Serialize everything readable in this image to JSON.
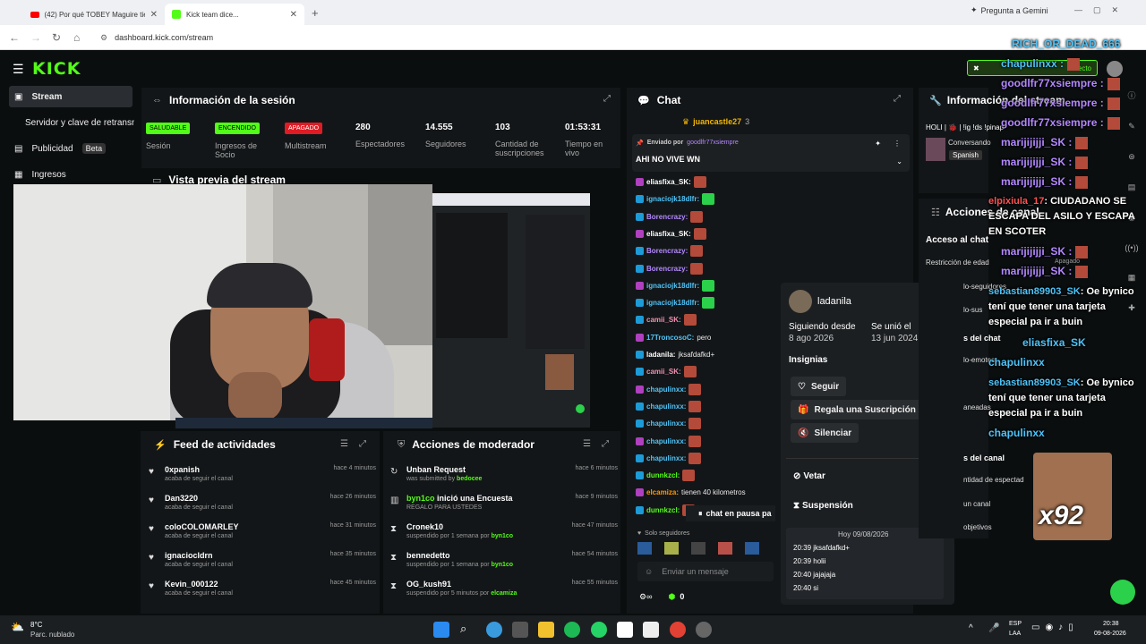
{
  "browser": {
    "tabs": [
      {
        "title": "(42) Por qué TOBEY Maguire tie"
      },
      {
        "title": "Kick team dice..."
      }
    ],
    "url": "dashboard.kick.com/stream",
    "gemini": "Pregunta a Gemini"
  },
  "kick": {
    "logo": "KICK",
    "sidebar": [
      {
        "label": "Stream"
      },
      {
        "label": "Servidor y clave de retransn"
      },
      {
        "label": "Publicidad",
        "badge": "Beta"
      },
      {
        "label": "Ingresos"
      }
    ],
    "session": {
      "title": "Información de la sesión",
      "stats": [
        {
          "pill": "SALUDABLE",
          "label": "Sesión",
          "color": "#53fc18"
        },
        {
          "pill": "ENCENDIDO",
          "label": "Ingresos de Socio",
          "color": "#53fc18"
        },
        {
          "pill": "APAGADO",
          "label": "Multistream",
          "color": "#e01b24"
        },
        {
          "value": "280",
          "label": "Espectadores"
        },
        {
          "value": "14.555",
          "label": "Seguidores"
        },
        {
          "value": "103",
          "label": "Cantidad de suscripciones"
        },
        {
          "value": "01:53:31",
          "label": "Tiempo en vivo"
        }
      ]
    },
    "preview": {
      "title": "Vista previa del stream"
    },
    "feed": {
      "title": "Feed de actividades",
      "rows": [
        {
          "name": "0xpanish",
          "sub": "acaba de seguir el canal",
          "time": "hace 4 minutos"
        },
        {
          "name": "Dan3220",
          "sub": "acaba de seguir el canal",
          "time": "hace 26 minutos"
        },
        {
          "name": "coloCOLOMARLEY",
          "sub": "acaba de seguir el canal",
          "time": "hace 31 minutos"
        },
        {
          "name": "ignaciocldrn",
          "sub": "acaba de seguir el canal",
          "time": "hace 35 minutos"
        },
        {
          "name": "Kevin_000122",
          "sub": "acaba de seguir el canal",
          "time": "hace 45 minutos"
        }
      ]
    },
    "mod": {
      "title": "Acciones de moderador",
      "rows": [
        {
          "icon": "refresh-icon",
          "name": "Unban Request",
          "sub": "was submitted by",
          "who": "bedocee",
          "time": "hace 6 minutos"
        },
        {
          "icon": "poll-icon",
          "name": "byn1co",
          "name2": "inició una Encuesta",
          "sub": "REGALO PARA USTEDES",
          "time": "hace 9 minutos"
        },
        {
          "icon": "hourglass-icon",
          "name": "Cronek10",
          "sub": "suspendido por 1 semana por",
          "who": "byn1co",
          "time": "hace 47 minutos"
        },
        {
          "icon": "hourglass-icon",
          "name": "bennedetto",
          "sub": "suspendido por 1 semana por",
          "who": "byn1co",
          "time": "hace 54 minutos"
        },
        {
          "icon": "hourglass-icon",
          "name": "OG_kush91",
          "sub": "suspendido por 5 minutos por",
          "who": "elcamiza",
          "time": "hace 55 minutos"
        }
      ]
    },
    "chat": {
      "title": "Chat",
      "top_user": "juancastle27",
      "top_count": "3",
      "pinned_by_label": "Enviado por",
      "pinned_by": "goodlfr77xsiempre",
      "pinned_text": "AHI NO VIVE WN",
      "lines": [
        {
          "user": "eliasfixa_SK:",
          "color": "#fff",
          "text": ""
        },
        {
          "user": "ignaciojk18dlfr:",
          "color": "#4fc3f7",
          "text": ""
        },
        {
          "user": "Borencrazy:",
          "color": "#b388ff",
          "text": ""
        },
        {
          "user": "eliasfixa_SK:",
          "color": "#fff",
          "text": ""
        },
        {
          "user": "Borencrazy:",
          "color": "#b388ff",
          "text": ""
        },
        {
          "user": "Borencrazy:",
          "color": "#b388ff",
          "text": ""
        },
        {
          "user": "ignaciojk18dlfr:",
          "color": "#4fc3f7",
          "text": ""
        },
        {
          "user": "ignaciojk18dlfr:",
          "color": "#4fc3f7",
          "text": ""
        },
        {
          "user": "camii_SK:",
          "color": "#f48fb1",
          "text": ""
        },
        {
          "user": "17TroncosoC:",
          "color": "#4fc3f7",
          "text": "pero"
        },
        {
          "user": "ladanila:",
          "color": "#fff",
          "text": "jksafdafkd+"
        },
        {
          "user": "camii_SK:",
          "color": "#f48fb1",
          "text": ""
        },
        {
          "user": "chapulinxx:",
          "color": "#4fc3f7",
          "text": ""
        },
        {
          "user": "chapulinxx:",
          "color": "#4fc3f7",
          "text": ""
        },
        {
          "user": "chapulinxx:",
          "color": "#4fc3f7",
          "text": ""
        },
        {
          "user": "chapulinxx:",
          "color": "#4fc3f7",
          "text": ""
        },
        {
          "user": "chapulinxx:",
          "color": "#4fc3f7",
          "text": ""
        },
        {
          "user": "dunnkzcl:",
          "color": "#53fc18",
          "text": ""
        },
        {
          "user": "elcamiza:",
          "color": "#ff9800",
          "text": "tienen 40 kilometros"
        },
        {
          "user": "dunnkzcl:",
          "color": "#53fc18",
          "text": ""
        }
      ],
      "paused": "chat en pausa pa",
      "followers_only": "Solo seguidores",
      "input_placeholder": "Enviar un mensaje",
      "points": "0"
    },
    "user_card": {
      "name": "ladanila",
      "following_since_label": "Siguiendo desde",
      "following_since": "8 ago 2026",
      "joined_label": "Se unió el",
      "joined": "13 jun 2024",
      "badges_label": "Insignias",
      "follow": "Seguir",
      "gift": "Regala una Suscripción",
      "silence": "Silenciar",
      "veto": "Vetar",
      "suspend": "Suspensión",
      "day": "Hoy 09/08/2026",
      "messages": [
        "20:39 jksafdafkd+",
        "20:39 holii",
        "20:40 jajajaja",
        "20:40 si"
      ]
    },
    "stream_info": {
      "title": "Información del stream",
      "desc": "HOLI | 🐞 | !ig !ds !pinap",
      "category": "Conversando",
      "lang": "Spanish"
    },
    "channel_actions": {
      "title": "Acciones de canal",
      "chat_access": "Acceso al chat",
      "items": [
        "Restricción de edad",
        "lo-seguidores",
        "lo-sus",
        "s del chat",
        "lo-emotes",
        "aneadas",
        "s del canal",
        "ntidad de espectad",
        "un canal",
        "objetivos"
      ],
      "off": "Apagado",
      "live_label": "directo"
    }
  },
  "overlay": {
    "top_name": "RICH_OR_DEAD_666",
    "lines": [
      {
        "name": "chapulinxx",
        "color": "#4fc3f7"
      },
      {
        "name": "goodlfr77xsiempre",
        "color": "#b388ff"
      },
      {
        "name": "goodlfr77xsiempre",
        "color": "#b388ff"
      },
      {
        "name": "goodlfr77xsiempre",
        "color": "#b388ff"
      },
      {
        "name": "marijijijji_SK",
        "color": "#b388ff"
      },
      {
        "name": "marijijijji_SK",
        "color": "#b388ff"
      },
      {
        "name": "marijijijji_SK",
        "color": "#b388ff"
      }
    ],
    "elpi_name": "elpixiula_17",
    "elpi_msg": ": CIUDADANO SE ESCAPA DEL ASILO Y ESCAPA EN SCOTER",
    "lines2": [
      {
        "name": "marijijijji_SK",
        "color": "#b388ff"
      },
      {
        "name": "marijijijji_SK",
        "color": "#b388ff"
      }
    ],
    "seb_name": "sebastian89903_SK",
    "seb_msg": ": Oe bynico tení que tener una tarjeta especial pa ir a buin",
    "elias": "eliasfixa_SK",
    "chap2": "chapulinxx",
    "seb2_name": "sebastian89903_SK",
    "seb2_msg": ": Oe bynico tení que tener una tarjeta especial pa ir a buin",
    "chap3": "chapulinxx",
    "x92": "x92"
  },
  "taskbar": {
    "temp": "8°C",
    "weather": "Parc. nublado",
    "lang": "ESP",
    "lang2": "LAA",
    "time": "20:38",
    "date": "09-08-2026"
  }
}
